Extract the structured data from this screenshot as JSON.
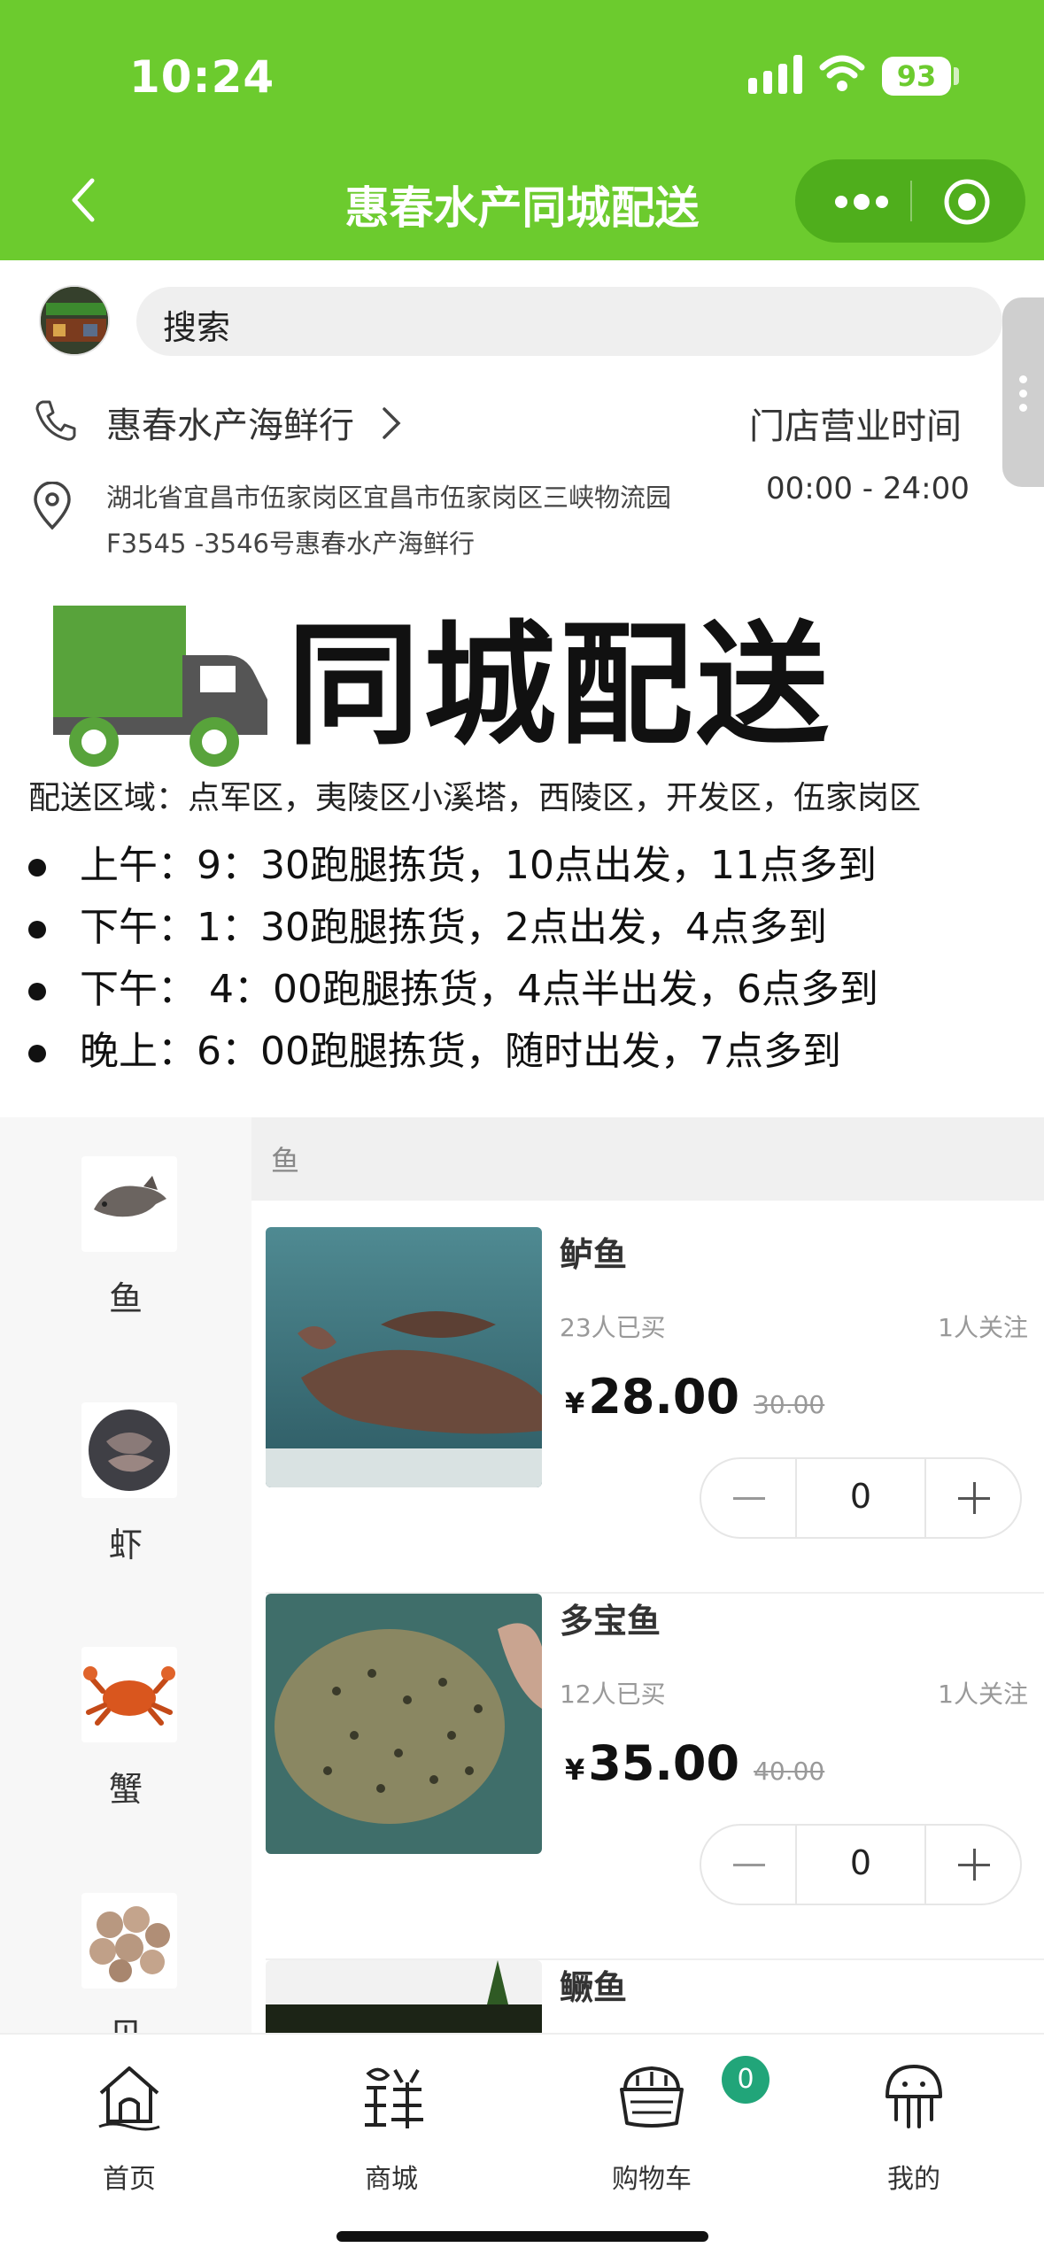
{
  "status_bar": {
    "time": "10:24",
    "battery": "93"
  },
  "nav": {
    "title": "惠春水产同城配送"
  },
  "search": {
    "placeholder": "搜索"
  },
  "store": {
    "name": "惠春水产海鲜行",
    "hours_label": "门店营业时间",
    "hours_value": "00:00 - 24:00",
    "address": "湖北省宜昌市伍家岗区宜昌市伍家岗区三峡物流园F3545 -3546号惠春水产海鲜行"
  },
  "banner": {
    "title": "同城配送",
    "delivery_area": "配送区域：点军区，夷陵区小溪塔，西陵区，开发区，伍家岗区",
    "schedule": [
      "上午：9：30跑腿拣货，10点出发，11点多到",
      "下午：1：30跑腿拣货，2点出发，4点多到",
      "下午： 4：00跑腿拣货，4点半出发，6点多到",
      "晚上：6：00跑腿拣货，随时出发，7点多到"
    ]
  },
  "categories": [
    {
      "label": "鱼",
      "icon": "fish-icon"
    },
    {
      "label": "虾",
      "icon": "shrimp-icon"
    },
    {
      "label": "蟹",
      "icon": "crab-icon"
    },
    {
      "label": "贝",
      "icon": "shellfish-icon"
    }
  ],
  "section": {
    "title": "鱼"
  },
  "products": [
    {
      "name": "鲈鱼",
      "sold": "23人已买",
      "follow": "1人关注",
      "currency": "¥",
      "price": "28.00",
      "original_price": "30.00",
      "qty": "0"
    },
    {
      "name": "多宝鱼",
      "sold": "12人已买",
      "follow": "1人关注",
      "currency": "¥",
      "price": "35.00",
      "original_price": "40.00",
      "qty": "0"
    },
    {
      "name": "鳜鱼"
    }
  ],
  "tabbar": {
    "items": [
      {
        "label": "首页",
        "icon": "home-icon"
      },
      {
        "label": "商城",
        "icon": "mall-icon"
      },
      {
        "label": "购物车",
        "icon": "cart-icon"
      },
      {
        "label": "我的",
        "icon": "profile-icon"
      }
    ],
    "cart_badge": "0"
  },
  "colors": {
    "brand_green": "#6ccb2e",
    "badge_green": "#21a579"
  }
}
